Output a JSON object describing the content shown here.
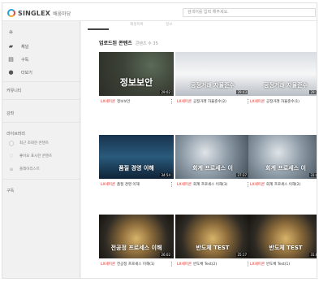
{
  "header": {
    "brand": "SINGLEX",
    "brand_sub": "배움마당",
    "search_placeholder": "검색어를 입력 해주세요."
  },
  "sidebar": {
    "items": [
      {
        "icon": "home-icon",
        "label": ""
      },
      {
        "icon": "channel-icon",
        "label": "채널"
      },
      {
        "icon": "subscribe-icon",
        "label": "구독"
      },
      {
        "icon": "user-icon",
        "label": "더보기"
      }
    ],
    "sections": {
      "community": "커뮤니티",
      "learning": "강좌",
      "library": "라이브러리",
      "subscribe": "구독"
    },
    "library_items": [
      {
        "icon": "history-icon",
        "label": "최근 조회한 콘텐츠"
      },
      {
        "icon": "heart-icon",
        "label": "좋아요 표시한 콘텐츠"
      },
      {
        "icon": "playlist-icon",
        "label": "플레이리스트"
      }
    ]
  },
  "main": {
    "tabs": [
      "",
      "재생목록",
      "정보"
    ],
    "heading": "업로드된 콘텐츠",
    "count_text": "콘텐츠 수 35",
    "cards": [
      {
        "thumb_title": "정보보안",
        "duration": "29:02",
        "uploader": "LX세미콘",
        "title": "정보보안",
        "bg": "bg-green",
        "big": true
      },
      {
        "thumb_title": "공정거래 자율준수",
        "duration": "29:43",
        "uploader": "LX세미콘",
        "title": "공정거래 자율준수(2)",
        "bg": "bg-shake",
        "big": false
      },
      {
        "thumb_title": "공정거래 자율준수",
        "duration": "29:32",
        "uploader": "LX세미콘",
        "title": "공정거래 자율준수(1)",
        "bg": "bg-shake",
        "big": false
      },
      {
        "thumb_title": "품질 경영 이해",
        "duration": "34:54",
        "uploader": "LX세미콘",
        "title": "품질 경영 이해",
        "bg": "bg-blue",
        "big": false
      },
      {
        "thumb_title": "회계 프로세스 이",
        "duration": "27:37",
        "uploader": "LX세미콘",
        "title": "회계 프로세스 이해(3)",
        "bg": "bg-metal",
        "big": false
      },
      {
        "thumb_title": "회계 프로세스 이",
        "duration": "31:43",
        "uploader": "LX세미콘",
        "title": "회계 프로세스 이해(2)",
        "bg": "bg-metal",
        "big": false
      },
      {
        "thumb_title": "전공정 프로세스 이해",
        "duration": "26:02",
        "uploader": "LX세미콘",
        "title": "전공정 프로세스 이해(1)",
        "bg": "bg-wafer",
        "big": false
      },
      {
        "thumb_title": "반도체 TEST",
        "duration": "25:17",
        "uploader": "LX세미콘",
        "title": "반도체 Test(2)",
        "bg": "bg-wafer",
        "big": false
      },
      {
        "thumb_title": "반도체 TEST",
        "duration": "31:01",
        "uploader": "LX세미콘",
        "title": "반도체 Test(1)",
        "bg": "bg-wafer",
        "big": false
      }
    ]
  }
}
